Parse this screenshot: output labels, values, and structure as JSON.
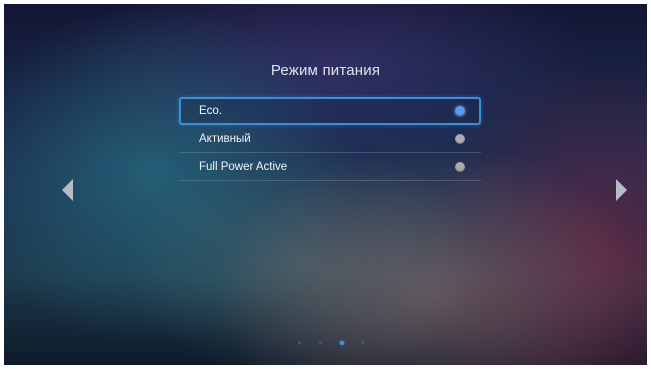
{
  "screen": {
    "title": "Режим питания"
  },
  "menu": {
    "options": [
      {
        "label": "Eco.",
        "selected": true
      },
      {
        "label": "Активный",
        "selected": false
      },
      {
        "label": "Full Power Active",
        "selected": false
      }
    ]
  },
  "navigation": {
    "left_arrow_icon": "triangle-left-icon",
    "right_arrow_icon": "triangle-right-icon",
    "page_indicator": {
      "count": 4,
      "active_index": 2
    }
  },
  "colors": {
    "accent": "#3a8fd6",
    "selected_radio": "#5a9df0",
    "unselected_radio": "#a9abb0",
    "text": "#f2f4f7"
  }
}
